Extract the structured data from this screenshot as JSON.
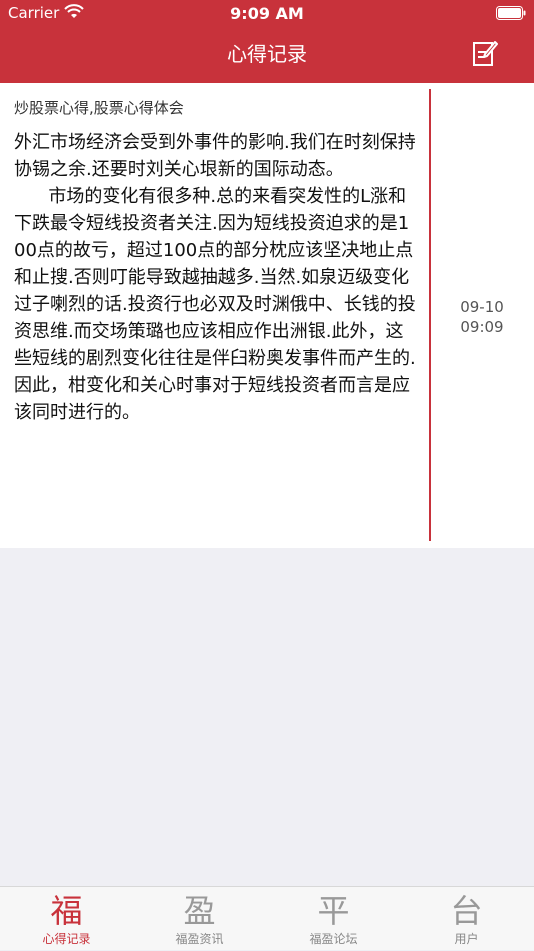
{
  "status_bar": {
    "carrier": "Carrier",
    "time": "9:09 AM",
    "wifi_icon": "wifi-icon",
    "battery_icon": "battery-icon"
  },
  "nav": {
    "title": "心得记录",
    "edit_icon": "edit-note-icon"
  },
  "note": {
    "subtitle": "炒股票心得,股票心得体会",
    "body": "外汇市场经济会受到外事件的影响.我们在时刻保持协锡之余.还要时刘关心垠新的国际动态。\n      市场的变化有很多种.总的来看突发性的L涨和下跌最令短线投资者关注.因为短线投资迫求的是100点的故亏，超过100点的部分枕应该坚决地止点和止搜.否则叮能导致越抽越多.当然.如泉迈级变化过子喇烈的话.投资行也必双及时渊俄中、长钱的投资思维.而交场策璐也应该相应作出洲银.此外，这些短线的剧烈变化往往是伴臼粉奥发事件而产生的.因此，柑变化和关心时事对于短线投资者而言是应该同时进行的。",
    "date": "09-10",
    "time": "09:09"
  },
  "tabs": [
    {
      "glyph": "福",
      "label": "心得记录",
      "active": true
    },
    {
      "glyph": "盈",
      "label": "福盈资讯",
      "active": false
    },
    {
      "glyph": "平",
      "label": "福盈论坛",
      "active": false
    },
    {
      "glyph": "台",
      "label": "用户",
      "active": false
    }
  ],
  "colors": {
    "accent": "#c8323b",
    "background": "#efeff4"
  }
}
